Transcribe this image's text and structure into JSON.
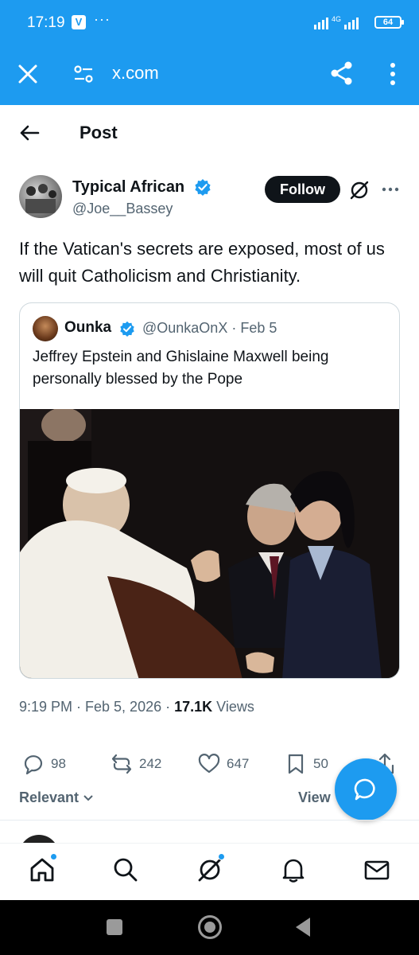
{
  "status_bar": {
    "time": "17:19",
    "app_badge": "V",
    "more": "···",
    "network": "4G",
    "battery": "64"
  },
  "browser": {
    "url": "x.com"
  },
  "header": {
    "title": "Post"
  },
  "post": {
    "author_name": "Typical African",
    "author_handle": "@Joe__Bassey",
    "follow_label": "Follow",
    "text": "If the Vatican's secrets are exposed, most of us will quit Catholicism and Christianity.",
    "timestamp": "9:19 PM · Feb 5, 2026 · ",
    "views_count": "17.1K",
    "views_label": " Views"
  },
  "quote": {
    "author_name": "Ounka",
    "author_handle": "@OunkaOnX · Feb 5",
    "text": "Jeffrey Epstein and Ghislaine Maxwell being personally blessed by the Pope"
  },
  "actions": {
    "replies": "98",
    "reposts": "242",
    "likes": "647",
    "bookmarks": "50"
  },
  "replies_section": {
    "sort_label": "Relevant",
    "view_label": "View"
  },
  "colors": {
    "brand": "#1d9bf0",
    "text": "#0f1419",
    "muted": "#536471"
  }
}
